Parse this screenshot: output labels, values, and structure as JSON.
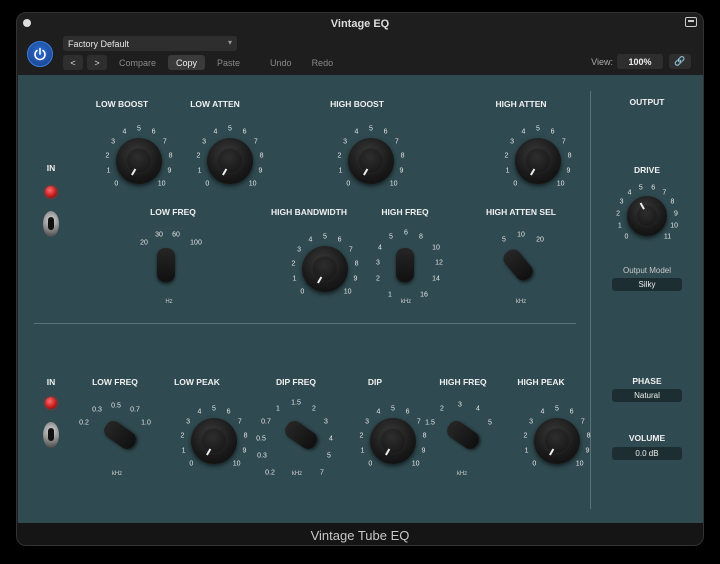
{
  "window": {
    "title": "Vintage EQ",
    "footer_title": "Vintage Tube EQ"
  },
  "toolbar": {
    "preset": "Factory Default",
    "prev": "<",
    "next": ">",
    "compare": "Compare",
    "copy": "Copy",
    "paste": "Paste",
    "undo": "Undo",
    "redo": "Redo",
    "view_label": "View:",
    "view_value": "100%"
  },
  "section_top": {
    "in_label": "IN",
    "low_boost": "LOW BOOST",
    "low_atten": "LOW ATTEN",
    "high_boost": "HIGH BOOST",
    "high_atten": "HIGH ATTEN",
    "low_freq": "LOW FREQ",
    "high_bandwidth": "HIGH BANDWIDTH",
    "high_freq": "HIGH FREQ",
    "high_atten_sel": "HIGH ATTEN SEL",
    "scale": [
      "0",
      "1",
      "2",
      "3",
      "4",
      "5",
      "6",
      "7",
      "8",
      "9",
      "10"
    ],
    "low_freq_opts": [
      "20",
      "30",
      "60",
      "100"
    ],
    "low_freq_unit": "Hz",
    "high_freq_opts": [
      "1",
      "2",
      "3",
      "4",
      "5",
      "6",
      "8",
      "10",
      "12",
      "14",
      "16"
    ],
    "high_freq_unit": "kHz",
    "atten_sel_opts": [
      "5",
      "10",
      "20"
    ],
    "atten_sel_unit": "kHz"
  },
  "output": {
    "title": "OUTPUT",
    "drive": "DRIVE",
    "drive_scale": [
      "0",
      "1",
      "2",
      "3",
      "4",
      "5",
      "6",
      "7",
      "8",
      "9",
      "10",
      "11"
    ],
    "model_label": "Output Model",
    "model_value": "Silky",
    "phase_label": "PHASE",
    "phase_value": "Natural",
    "volume_label": "VOLUME",
    "volume_value": "0.0 dB"
  },
  "section_bottom": {
    "in_label": "IN",
    "low_freq": "LOW FREQ",
    "low_peak": "LOW PEAK",
    "dip_freq": "DIP FREQ",
    "dip": "DIP",
    "high_freq": "HIGH FREQ",
    "high_peak": "HIGH PEAK",
    "low_freq_opts": [
      "0.2",
      "0.3",
      "0.5",
      "0.7",
      "1.0"
    ],
    "low_freq_unit": "kHz",
    "dip_freq_opts": [
      "0.2",
      "0.3",
      "0.5",
      "0.7",
      "1",
      "1.5",
      "2",
      "3",
      "4",
      "5",
      "7"
    ],
    "dip_freq_unit": "kHz",
    "high_freq_opts": [
      "1.5",
      "2",
      "3",
      "4",
      "5"
    ],
    "high_freq_unit": "kHz"
  }
}
